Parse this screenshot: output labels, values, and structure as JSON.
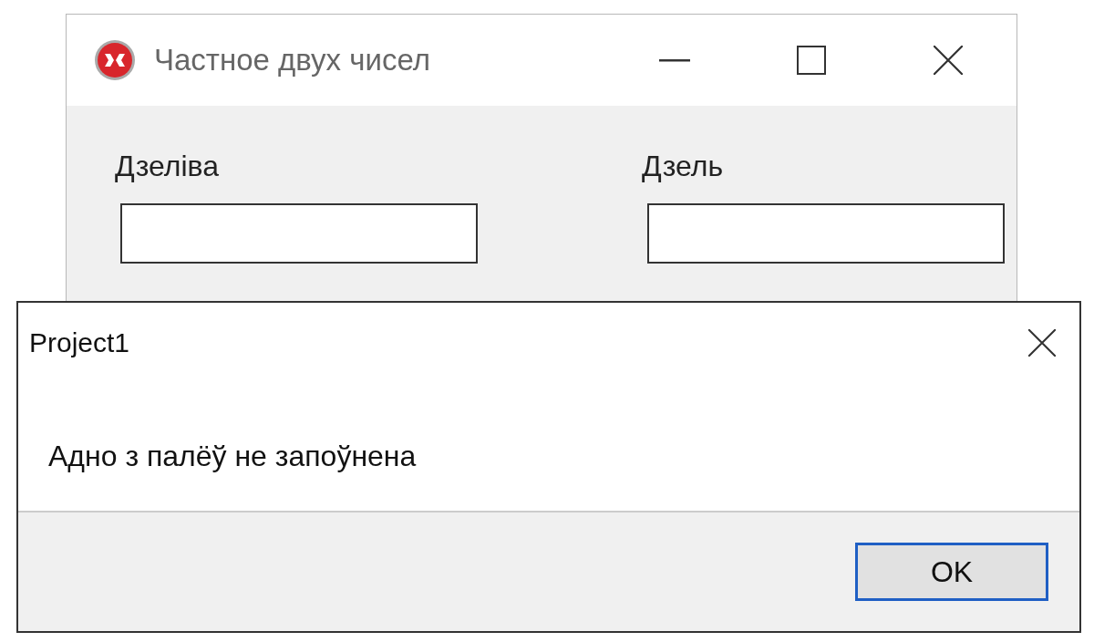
{
  "main_window": {
    "title": "Частное двух чисел",
    "fields": [
      {
        "label": "Дзеліва"
      },
      {
        "label": "Дзель"
      }
    ]
  },
  "dialog": {
    "title": "Project1",
    "message": "Адно з палёў не запоўнена",
    "buttons": [
      {
        "label": "OK",
        "default": true
      }
    ]
  }
}
